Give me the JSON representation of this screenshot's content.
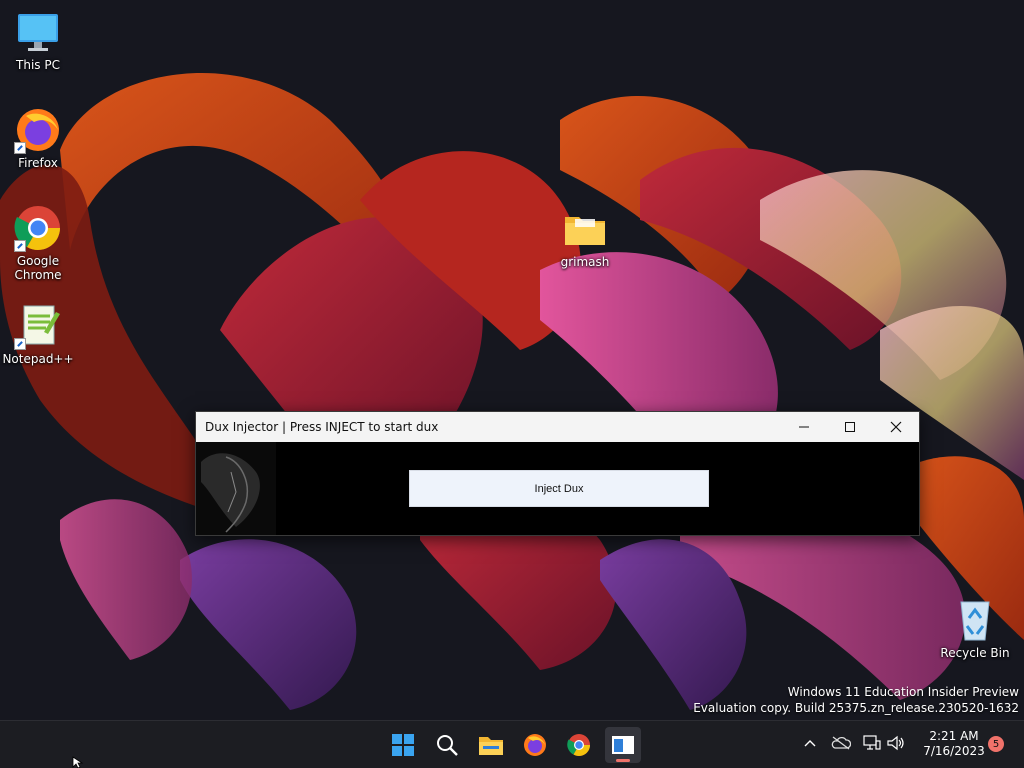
{
  "desktop": {
    "icons": [
      {
        "label": "This PC",
        "icon": "monitor-icon"
      },
      {
        "label": "Firefox",
        "icon": "firefox-icon"
      },
      {
        "label": "Google Chrome",
        "icon": "chrome-icon"
      },
      {
        "label": "Notepad++",
        "icon": "notepadpp-icon"
      },
      {
        "label": "grimash",
        "icon": "folder-icon"
      },
      {
        "label": "Recycle Bin",
        "icon": "recycle-bin-icon"
      }
    ],
    "watermark": {
      "line1": "Windows 11 Education Insider Preview",
      "line2": "Evaluation copy. Build 25375.zn_release.230520-1632"
    }
  },
  "dialog": {
    "title": "Dux Injector | Press INJECT to start dux",
    "inject_label": "Inject Dux"
  },
  "taskbar": {
    "clock_time": "2:21 AM",
    "clock_date": "7/16/2023",
    "notification_count": "5",
    "pinned": [
      "start-icon",
      "search-icon",
      "file-explorer-icon",
      "firefox-icon",
      "chrome-icon",
      "dux-app-icon"
    ]
  },
  "colors": {
    "taskbar_bg": "#1c1d22",
    "dialog_bg": "#000000",
    "button_bg": "#eef3fb",
    "notification_badge": "#f0726a"
  }
}
